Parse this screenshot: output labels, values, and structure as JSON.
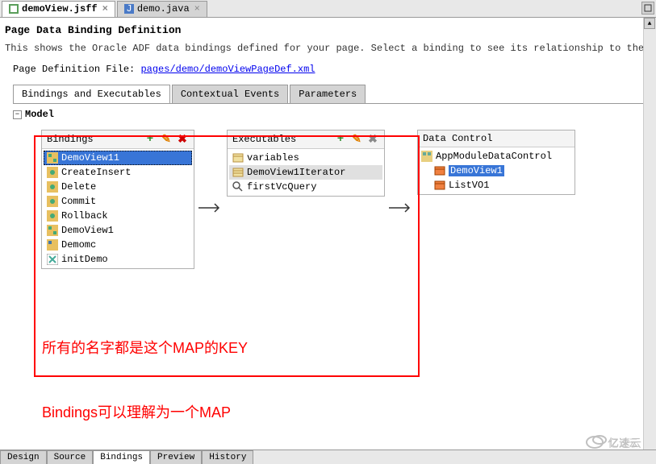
{
  "tabs_top": [
    {
      "label": "demoView.jsff",
      "active": true
    },
    {
      "label": "demo.java",
      "active": false
    }
  ],
  "title": "Page Data Binding Definition",
  "description": "This shows the Oracle ADF data bindings defined for your page. Select a binding to see its relationship to the underlying Data Contro",
  "file_label": "Page Definition File:",
  "file_link": "pages/demo/demoViewPageDef.xml",
  "inner_tabs": [
    {
      "label": "Bindings and Executables",
      "active": true
    },
    {
      "label": "Contextual Events",
      "active": false
    },
    {
      "label": "Parameters",
      "active": false
    }
  ],
  "model_label": "Model",
  "panels": {
    "bindings": {
      "title": "Bindings",
      "items": [
        {
          "label": "DemoView11",
          "selected": true
        },
        {
          "label": "CreateInsert"
        },
        {
          "label": "Delete"
        },
        {
          "label": "Commit"
        },
        {
          "label": "Rollback"
        },
        {
          "label": "DemoView1"
        },
        {
          "label": "Demomc"
        },
        {
          "label": "initDemo"
        }
      ]
    },
    "executables": {
      "title": "Executables",
      "items": [
        {
          "label": "variables"
        },
        {
          "label": "DemoView1Iterator",
          "highlighted": true
        },
        {
          "label": "firstVcQuery"
        }
      ]
    },
    "datacontrol": {
      "title": "Data Control",
      "root": "AppModuleDataControl",
      "items": [
        {
          "label": "DemoView1",
          "selected": true
        },
        {
          "label": "ListVO1"
        }
      ]
    }
  },
  "annotations": {
    "text1": "所有的名字都是这个MAP的KEY",
    "text2": "Bindings可以理解为一个MAP"
  },
  "bottom_tabs": [
    {
      "label": "Design"
    },
    {
      "label": "Source"
    },
    {
      "label": "Bindings",
      "active": true
    },
    {
      "label": "Preview"
    },
    {
      "label": "History"
    }
  ],
  "logo_text": "亿速云"
}
